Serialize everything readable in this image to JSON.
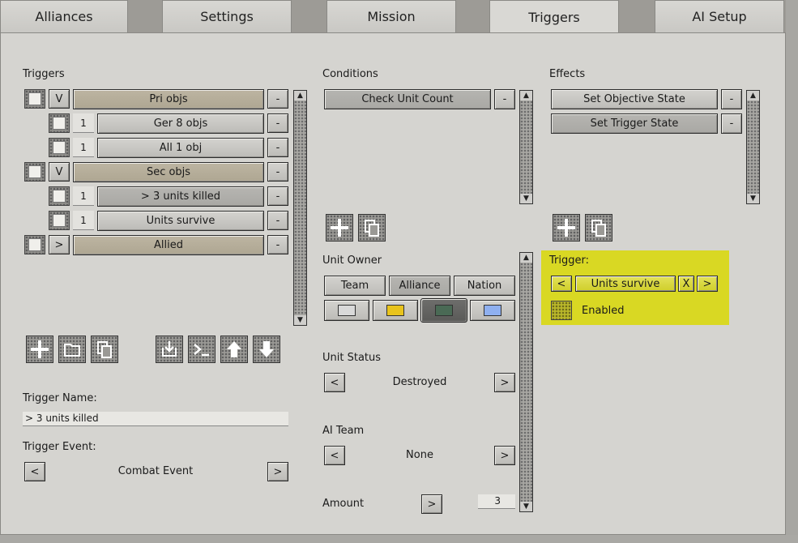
{
  "tabs": [
    "Alliances",
    "Settings",
    "Mission",
    "Triggers",
    "AI Setup"
  ],
  "triggers": {
    "label": "Triggers",
    "rows": [
      {
        "toggle": "V",
        "count": "",
        "name": "Pri objs",
        "group": true
      },
      {
        "toggle": "",
        "count": "1",
        "name": "Ger 8 objs",
        "group": false
      },
      {
        "toggle": "",
        "count": "1",
        "name": "All 1 obj",
        "group": false
      },
      {
        "toggle": "V",
        "count": "",
        "name": "Sec objs",
        "group": true
      },
      {
        "toggle": "",
        "count": "1",
        "name": "> 3 units killed",
        "group": false
      },
      {
        "toggle": "",
        "count": "1",
        "name": "Units survive",
        "group": false
      },
      {
        "toggle": ">",
        "count": "",
        "name": "Allied",
        "group": true
      }
    ],
    "remove_label": "-"
  },
  "trigger_name": {
    "label": "Trigger Name:",
    "value": "> 3 units killed"
  },
  "trigger_event": {
    "label": "Trigger Event:",
    "value": "Combat Event",
    "prev": "<",
    "next": ">"
  },
  "conditions": {
    "label": "Conditions",
    "items": [
      "Check Unit Count"
    ],
    "remove_label": "-"
  },
  "unit_owner": {
    "label": "Unit Owner",
    "options": [
      "Team",
      "Alliance",
      "Nation"
    ],
    "selected": "Alliance",
    "colors": [
      "#d9d9d9",
      "#e8c31c",
      "#4a6a55",
      "#8fb0f0"
    ]
  },
  "unit_status": {
    "label": "Unit Status",
    "value": "Destroyed",
    "prev": "<",
    "next": ">"
  },
  "ai_team": {
    "label": "AI Team",
    "value": "None",
    "prev": "<",
    "next": ">"
  },
  "amount": {
    "label": "Amount",
    "button": ">",
    "value": "3"
  },
  "effects": {
    "label": "Effects",
    "items": [
      "Set Objective State",
      "Set Trigger State"
    ],
    "remove_label": "-"
  },
  "trigger_link": {
    "label": "Trigger:",
    "prev": "<",
    "value": "Units survive",
    "clear": "X",
    "next": ">",
    "enabled_label": "Enabled"
  }
}
